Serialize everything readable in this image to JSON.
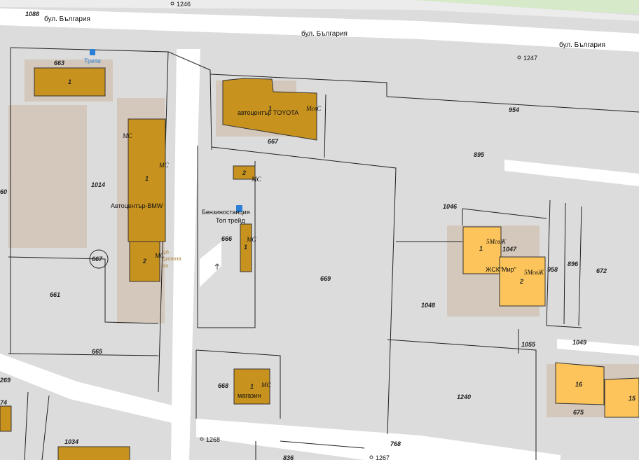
{
  "streets": {
    "north": "бул. България",
    "center": "бул. България",
    "east": "бул. България",
    "number_left": "1088"
  },
  "points": {
    "p1246": "1246",
    "p1247": "1247",
    "p1268": "1268",
    "p1267": "1267"
  },
  "parcels": {
    "p663": "663",
    "p1014": "1014",
    "p661": "661",
    "p665": "665",
    "p667": "667",
    "p667_circle": "667",
    "p666": "666",
    "p669": "669",
    "p668": "668",
    "p954": "954",
    "p895": "895",
    "p1046": "1046",
    "p1047": "1047",
    "p1048": "1048",
    "p958": "958",
    "p896": "896",
    "p672": "672",
    "p1049": "1049",
    "p1055": "1055",
    "p1240": "1240",
    "p675": "675",
    "p768": "768",
    "p1034": "1034",
    "edge_60": "60",
    "edge_269": "269",
    "edge_74": "74",
    "p836": "836"
  },
  "buildings": {
    "b663": "1",
    "bmw_1": "1",
    "bmw_2": "2",
    "toyota": "1",
    "b2": "2",
    "b_station": "1",
    "b_shop": "1",
    "jsk_1": "1",
    "jsk_2": "2",
    "b16": "16",
    "b15": "15"
  },
  "tags": {
    "ms": "МС",
    "msc": "МсвС",
    "msj": "5МсвЖ",
    "msj2": "5МсвЖ"
  },
  "labels": {
    "stop": "Трите",
    "bmw": "Автоцентър-BMW",
    "toyota": "автоцентър TOYOTA",
    "gas_line1": "Бензиностанция",
    "gas_line2": "Топ трейд",
    "shop": "магазин",
    "jsk": "ЖСК\"Мир\"",
    "faded_a": "ца",
    "faded_b": "ционна",
    "faded_c": "ка"
  },
  "colors": {
    "background": "#dcdcdc",
    "road": "#ffffff",
    "building_dark": "#c8921f",
    "building_light": "#fcc45a",
    "footprint": "#d2c1b2",
    "green": "#d6e9c9",
    "stop_icon": "#2b7fd6"
  }
}
